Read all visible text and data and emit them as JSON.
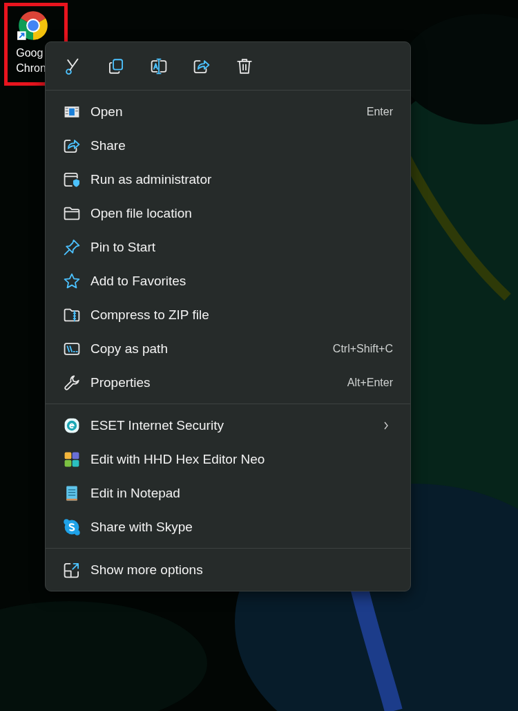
{
  "desktop_icon": {
    "label_lines": [
      "Goog",
      "Chron"
    ],
    "highlighted": true
  },
  "context_menu": {
    "toolbar": [
      {
        "kind": "cut"
      },
      {
        "kind": "copy"
      },
      {
        "kind": "rename"
      },
      {
        "kind": "share"
      },
      {
        "kind": "delete"
      }
    ],
    "sections": [
      {
        "items": [
          {
            "kind": "open",
            "label": "Open",
            "shortcut": "Enter"
          },
          {
            "kind": "share",
            "label": "Share"
          },
          {
            "kind": "admin",
            "label": "Run as administrator"
          },
          {
            "kind": "folder",
            "label": "Open file location"
          },
          {
            "kind": "pin",
            "label": "Pin to Start"
          },
          {
            "kind": "star",
            "label": "Add to Favorites"
          },
          {
            "kind": "zip",
            "label": "Compress to ZIP file"
          },
          {
            "kind": "path",
            "label": "Copy as path",
            "shortcut": "Ctrl+Shift+C"
          },
          {
            "kind": "wrench",
            "label": "Properties",
            "shortcut": "Alt+Enter"
          }
        ]
      },
      {
        "items": [
          {
            "kind": "eset",
            "label": "ESET Internet Security",
            "submenu": true
          },
          {
            "kind": "hex",
            "label": "Edit with HHD Hex Editor Neo"
          },
          {
            "kind": "notepad",
            "label": "Edit in Notepad"
          },
          {
            "kind": "skype",
            "label": "Share with Skype"
          }
        ]
      },
      {
        "items": [
          {
            "kind": "more",
            "label": "Show more options"
          }
        ]
      }
    ]
  }
}
